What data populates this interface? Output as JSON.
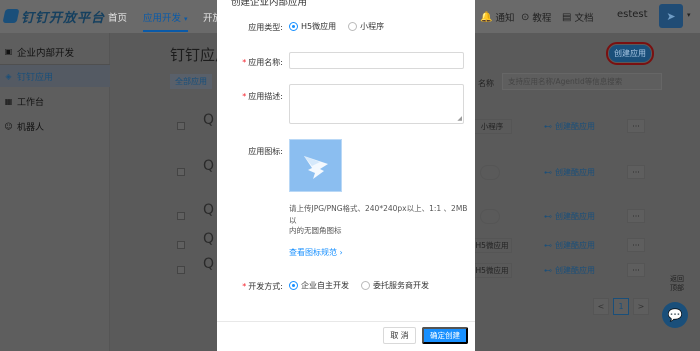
{
  "topbar": {
    "logo_text": "钉钉开放平台",
    "nav": [
      {
        "label": "首页"
      },
      {
        "label": "应用开发",
        "chevron": "chevron-down"
      },
      {
        "label": "开放"
      }
    ],
    "right": [
      {
        "icon": "bell",
        "label": "通知"
      },
      {
        "icon": "help-circle",
        "label": "教程"
      },
      {
        "icon": "document",
        "label": "文档"
      }
    ],
    "user": "estest",
    "avatar_icon": "paper-plane-logo"
  },
  "sidebar": {
    "header": "企业内部开发",
    "items": [
      {
        "label": "钉钉应用",
        "icon": "app-icon",
        "active": true
      },
      {
        "label": "工作台",
        "icon": "workbench-icon",
        "active": false
      },
      {
        "label": "机器人",
        "icon": "robot-icon",
        "active": false
      }
    ]
  },
  "main": {
    "title": "钉钉应用",
    "create_button": "创建应用",
    "filter_tab": "全部应用",
    "filter_label": "名称",
    "search_placeholder": "支持应用名称/AgentId等信息搜索",
    "rows": [
      {
        "tag": "小程序",
        "action": "创建酷应用",
        "more": "···"
      },
      {
        "tag": "",
        "action": "创建酷应用",
        "more": "···"
      },
      {
        "tag": "",
        "action": "创建酷应用",
        "more": "···"
      },
      {
        "tag": "H5微应用",
        "action": "创建酷应用",
        "more": "···"
      },
      {
        "tag": "H5微应用",
        "action": "创建酷应用",
        "more": "···"
      }
    ],
    "pagination": {
      "prev": "<",
      "current": "1",
      "next": ">"
    },
    "back_top": "返回\n顶部"
  },
  "modal": {
    "title": "创建企业内部应用",
    "app_type_label": "应用类型:",
    "app_type_options": [
      {
        "label": "H5微应用",
        "selected": true
      },
      {
        "label": "小程序",
        "selected": false
      }
    ],
    "name_label": "应用名称:",
    "name_value": "",
    "desc_label": "应用描述:",
    "desc_value": "",
    "icon_label": "应用图标:",
    "icon_hint_line1": "请上传JPG/PNG格式、240*240px以上、1:1 、2MB 以",
    "icon_hint_line2": "内的无圆角图标",
    "spec_link": "查看图标规范",
    "dev_mode_label": "开发方式:",
    "dev_mode_options": [
      {
        "label": "企业自主开发",
        "selected": true
      },
      {
        "label": "委托服务商开发",
        "selected": false
      }
    ],
    "cancel_button": "取 消",
    "confirm_button": "确定创建"
  },
  "colors": {
    "primary": "#1890ff",
    "required": "#f5222d",
    "overlay": "#5a5a5a"
  }
}
